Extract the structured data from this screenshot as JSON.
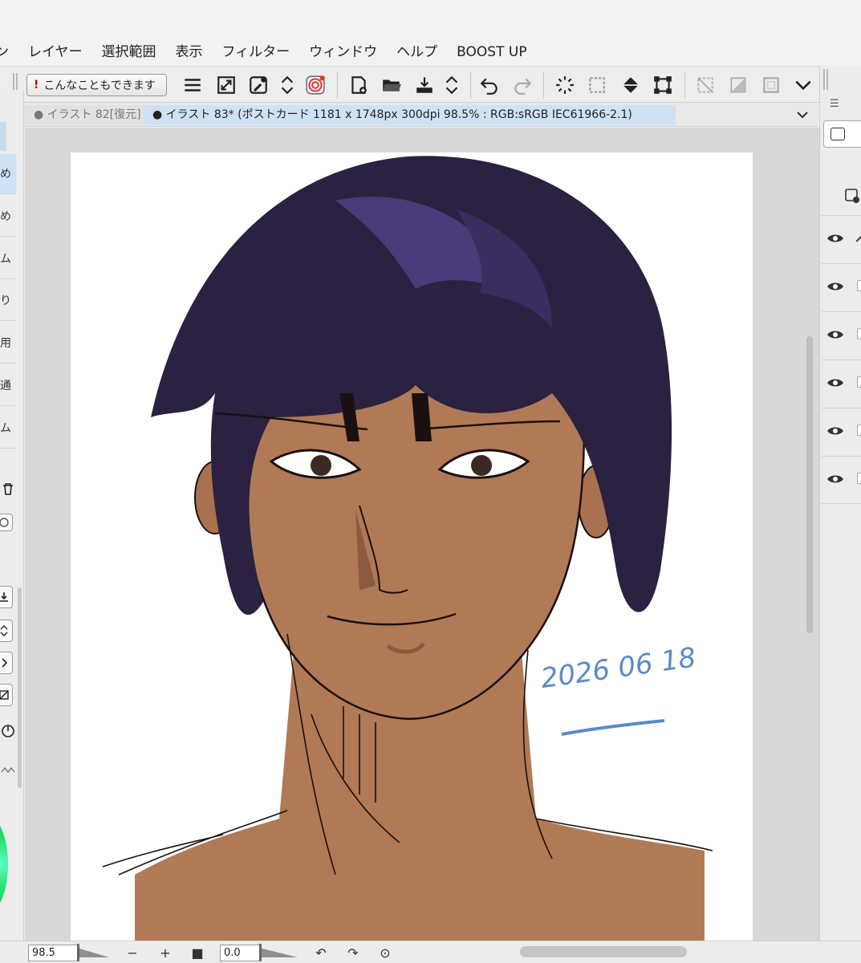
{
  "menu": [
    "ン",
    "レイヤー",
    "選択範囲",
    "表示",
    "フィルター",
    "ウィンドウ",
    "ヘルプ",
    "BOOST UP"
  ],
  "toolbar": {
    "tip_label": "こんなこともできます"
  },
  "tabs": {
    "inactive": "イラスト 82[復元]",
    "active": "イラスト 83* (ポストカード 1181 x 1748px 300dpi 98.5% : RGB:sRGB IEC61966-2.1)"
  },
  "left_panel": {
    "items": [
      "め",
      "め",
      "ム",
      "り",
      "用",
      "通",
      "ム"
    ]
  },
  "artwork": {
    "signature": "2026 06 18",
    "colors": {
      "hair": "#2b2140",
      "hair_highlight": "#4a3a7a",
      "skin": "#b07a57",
      "line": "#1a1010",
      "signature": "#5b8bc4"
    }
  },
  "status": {
    "zoom": "98.5",
    "angle": "0.0"
  },
  "colors": {
    "accent": "#cfe1f5",
    "toolbar_bg": "#ededed",
    "canvas_bg": "#d8d8d8"
  }
}
